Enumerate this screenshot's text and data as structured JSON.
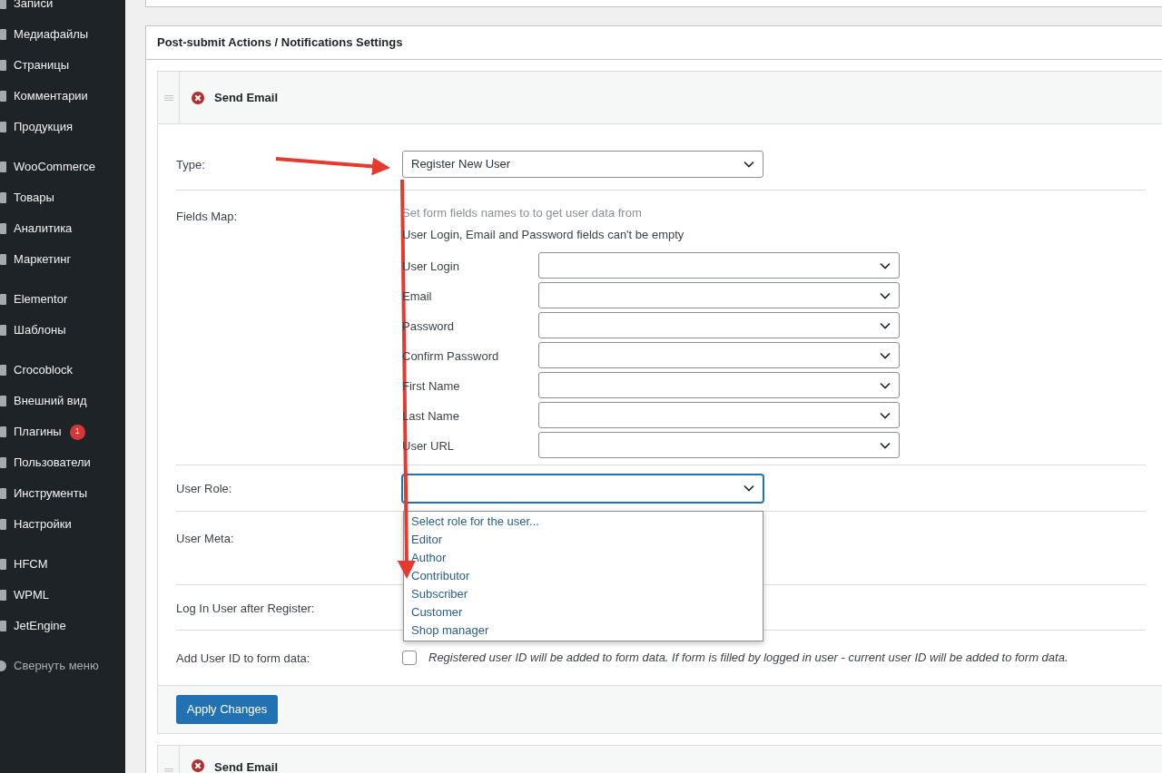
{
  "sidebar": {
    "groups": [
      {
        "items": [
          {
            "label": "Записи"
          },
          {
            "label": "Медиафайлы"
          },
          {
            "label": "Страницы"
          },
          {
            "label": "Комментарии"
          },
          {
            "label": "Продукция"
          }
        ]
      },
      {
        "items": [
          {
            "label": "WooCommerce"
          },
          {
            "label": "Товары"
          },
          {
            "label": "Аналитика"
          },
          {
            "label": "Маркетинг"
          }
        ]
      },
      {
        "items": [
          {
            "label": "Elementor"
          },
          {
            "label": "Шаблоны"
          }
        ]
      },
      {
        "items": [
          {
            "label": "Crocoblock"
          },
          {
            "label": "Внешний вид"
          },
          {
            "label": "Плагины",
            "badge": "1"
          },
          {
            "label": "Пользователи"
          },
          {
            "label": "Инструменты"
          },
          {
            "label": "Настройки"
          }
        ]
      },
      {
        "items": [
          {
            "label": "HFCM"
          },
          {
            "label": "WPML"
          },
          {
            "label": "JetEngine"
          }
        ]
      },
      {
        "items": [
          {
            "label": "Свернуть меню",
            "kind": "collapse"
          }
        ]
      }
    ]
  },
  "panel": {
    "title": "Post-submit Actions / Notifications Settings",
    "action": {
      "title": "Send Email",
      "type": {
        "label": "Type:",
        "value": "Register New User"
      },
      "fields_map": {
        "label": "Fields Map:",
        "hint": "Set form fields names to to get user data from",
        "note": "User Login, Email and Password fields can't be empty",
        "fields": [
          "User Login",
          "Email",
          "Password",
          "Confirm Password",
          "First Name",
          "Last Name",
          "User URL"
        ]
      },
      "user_role": {
        "label": "User Role:",
        "expanded": true,
        "options": [
          {
            "label": "Select role for the user...",
            "selected": false
          },
          {
            "label": "Editor",
            "selected": false
          },
          {
            "label": "Author",
            "selected": false
          },
          {
            "label": "Contributor",
            "selected": false
          },
          {
            "label": "Subscriber",
            "selected": false
          },
          {
            "label": "Customer",
            "selected": false
          },
          {
            "label": "Shop manager",
            "selected": false
          }
        ]
      },
      "user_meta": {
        "label": "User Meta:"
      },
      "log_in": {
        "label": "Log In User after Register:"
      },
      "add_user_id": {
        "label": "Add User ID to form data:",
        "checked": false,
        "description": "Registered user ID will be added to form data. If form is filled by logged in user - current user ID will be added to form data."
      },
      "apply_button": "Apply Changes"
    },
    "next_action": {
      "title": "Send Email"
    }
  }
}
